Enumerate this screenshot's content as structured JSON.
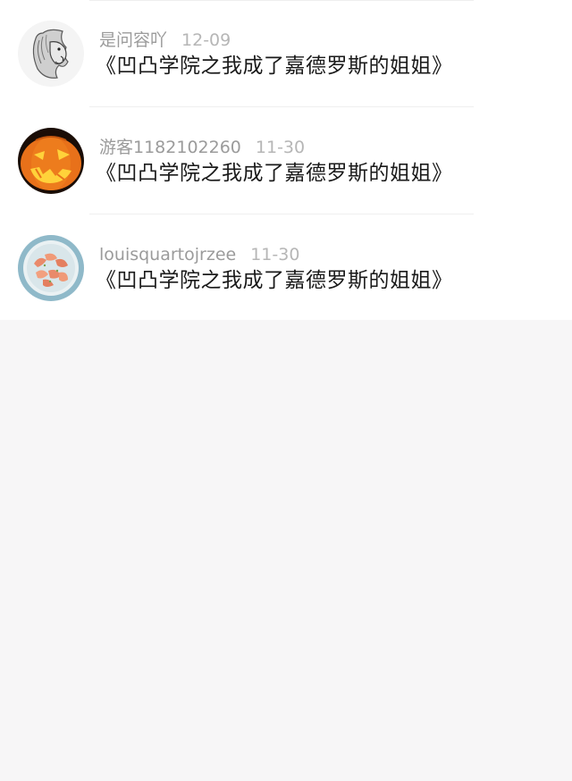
{
  "comments": [
    {
      "username": "是问容吖",
      "date": "12-09",
      "text": "《凹凸学院之我成了嘉德罗斯的姐姐》",
      "avatar_icon": "lion-sketch-avatar"
    },
    {
      "username": "游客1182102260",
      "date": "11-30",
      "text": "《凹凸学院之我成了嘉德罗斯的姐姐》",
      "avatar_icon": "jack-o-lantern-avatar"
    },
    {
      "username": "louisquartojrzee",
      "date": "11-30",
      "text": "《凹凸学院之我成了嘉德罗斯的姐姐》",
      "avatar_icon": "shrimp-dish-avatar"
    }
  ],
  "colors": {
    "page_background": "#f7f6f7",
    "list_background": "#ffffff",
    "username": "#9b9b9b",
    "date": "#b6b6b6",
    "text": "#1a1a1a"
  }
}
